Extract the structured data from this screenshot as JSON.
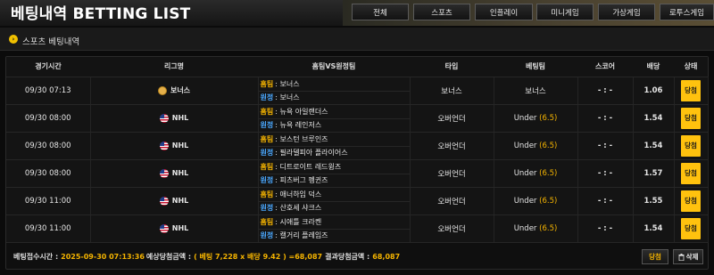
{
  "header": {
    "title": "베팅내역 BETTING LIST",
    "nav": [
      "전체",
      "스포츠",
      "인플레이",
      "미니게임",
      "가상게임",
      "로투스게임"
    ]
  },
  "subheader": {
    "icon": "arrow-right-icon",
    "title": "스포츠 베팅내역"
  },
  "table": {
    "columns": [
      "경기시간",
      "리그명",
      "홈팀VS원정팀",
      "타입",
      "베팅팀",
      "스코어",
      "배당",
      "상태"
    ],
    "home_tag": "홈팀",
    "away_tag": "원정",
    "rows": [
      {
        "time": "09/30 07:13",
        "league": "보너스",
        "league_icon": "bonus-icon",
        "home": ": 보너스",
        "away": ": 보너스",
        "type": "보너스",
        "pick": "보너스",
        "handicap": "",
        "score": "- : -",
        "odds": "1.06",
        "status": "당첨"
      },
      {
        "time": "09/30 08:00",
        "league": "NHL",
        "league_icon": "us-flag-icon",
        "home": ": 뉴욕 아일랜더스",
        "away": ": 뉴욕 레인저스",
        "type": "오버언더",
        "pick": "Under",
        "handicap": "(6.5)",
        "score": "- : -",
        "odds": "1.54",
        "status": "당첨"
      },
      {
        "time": "09/30 08:00",
        "league": "NHL",
        "league_icon": "us-flag-icon",
        "home": ": 보스턴 브루인즈",
        "away": ": 필라델피아 플라이어스",
        "type": "오버언더",
        "pick": "Under",
        "handicap": "(6.5)",
        "score": "- : -",
        "odds": "1.54",
        "status": "당첨"
      },
      {
        "time": "09/30 08:00",
        "league": "NHL",
        "league_icon": "us-flag-icon",
        "home": ": 디트로이트 레드윙즈",
        "away": ": 피츠버그 펭귄즈",
        "type": "오버언더",
        "pick": "Under",
        "handicap": "(6.5)",
        "score": "- : -",
        "odds": "1.57",
        "status": "당첨"
      },
      {
        "time": "09/30 11:00",
        "league": "NHL",
        "league_icon": "us-flag-icon",
        "home": ": 애너하임 덕스",
        "away": ": 산호세 샤크스",
        "type": "오버언더",
        "pick": "Under",
        "handicap": "(6.5)",
        "score": "- : -",
        "odds": "1.55",
        "status": "당첨"
      },
      {
        "time": "09/30 11:00",
        "league": "NHL",
        "league_icon": "us-flag-icon",
        "home": ": 시애틀 크라켄",
        "away": ": 캘거리 플레임즈",
        "type": "오버언더",
        "pick": "Under",
        "handicap": "(6.5)",
        "score": "- : -",
        "odds": "1.54",
        "status": "당첨"
      }
    ]
  },
  "footer": {
    "bet_time_label": "베팅접수시간 :",
    "bet_time": "2025-09-30 07:13:36",
    "expected_label": "예상당첨금액 :",
    "expected_value": "( 베팅 7,228 x 배당 9.42 ) =68,087",
    "result_label": "결과당첨금액 :",
    "result_value": "68,087",
    "status_button": "당첨",
    "delete_button": "삭제",
    "delete_icon": "trash-icon"
  },
  "colors": {
    "accent": "#f5b400",
    "away": "#4aa8ff",
    "status_bg": "#ffc20e"
  }
}
